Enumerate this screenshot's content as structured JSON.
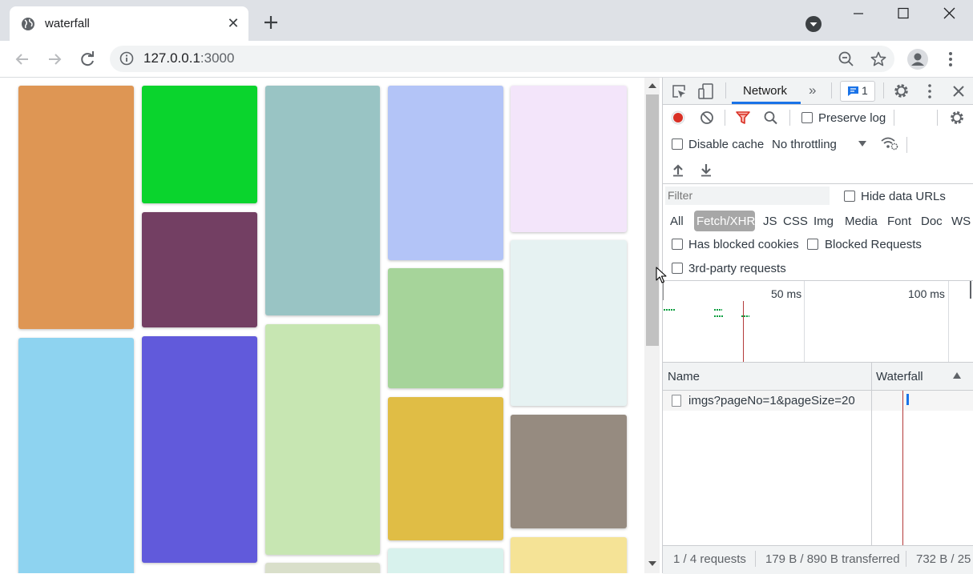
{
  "browser": {
    "tab_title": "waterfall",
    "tab_close": "✕",
    "url_host": "127.0.0.1",
    "url_port": ":3000"
  },
  "page_tiles": [
    {
      "color": "#de9654"
    },
    {
      "color": "#0ad42d"
    },
    {
      "color": "#733f63"
    },
    {
      "color": "#99c4c4"
    },
    {
      "color": "#b3c4f7"
    },
    {
      "color": "#f3e5fa"
    },
    {
      "color": "#8ed3f0"
    },
    {
      "color": "#615adb"
    },
    {
      "color": "#c7e6b2"
    },
    {
      "color": "#a6d49a"
    },
    {
      "color": "#e6f2f2"
    },
    {
      "color": "#e0bd45"
    },
    {
      "color": "#968b80"
    },
    {
      "color": "#d8f2ed"
    },
    {
      "color": "#f5e396"
    },
    {
      "color": "#d9dfca"
    }
  ],
  "devtools": {
    "panel_tab": "Network",
    "issues_count": "1",
    "preserve_log": "Preserve log",
    "disable_cache": "Disable cache",
    "throttling": "No throttling",
    "filter_placeholder": "Filter",
    "hide_data_urls": "Hide data URLs",
    "types": [
      "All",
      "Fetch/XHR",
      "JS",
      "CSS",
      "Img",
      "Media",
      "Font",
      "Doc",
      "WS"
    ],
    "selected_type": "Fetch/XHR",
    "has_blocked_cookies": "Has blocked cookies",
    "blocked_requests": "Blocked Requests",
    "third_party": "3rd-party requests",
    "timeline_ticks": [
      "50 ms",
      "100 ms"
    ],
    "columns": {
      "name": "Name",
      "waterfall": "Waterfall"
    },
    "requests": [
      {
        "name": "imgs?pageNo=1&pageSize=20"
      }
    ],
    "status": {
      "requests": "1 / 4 requests",
      "transferred": "179 B / 890 B transferred",
      "resources": "732 B / 25"
    }
  }
}
